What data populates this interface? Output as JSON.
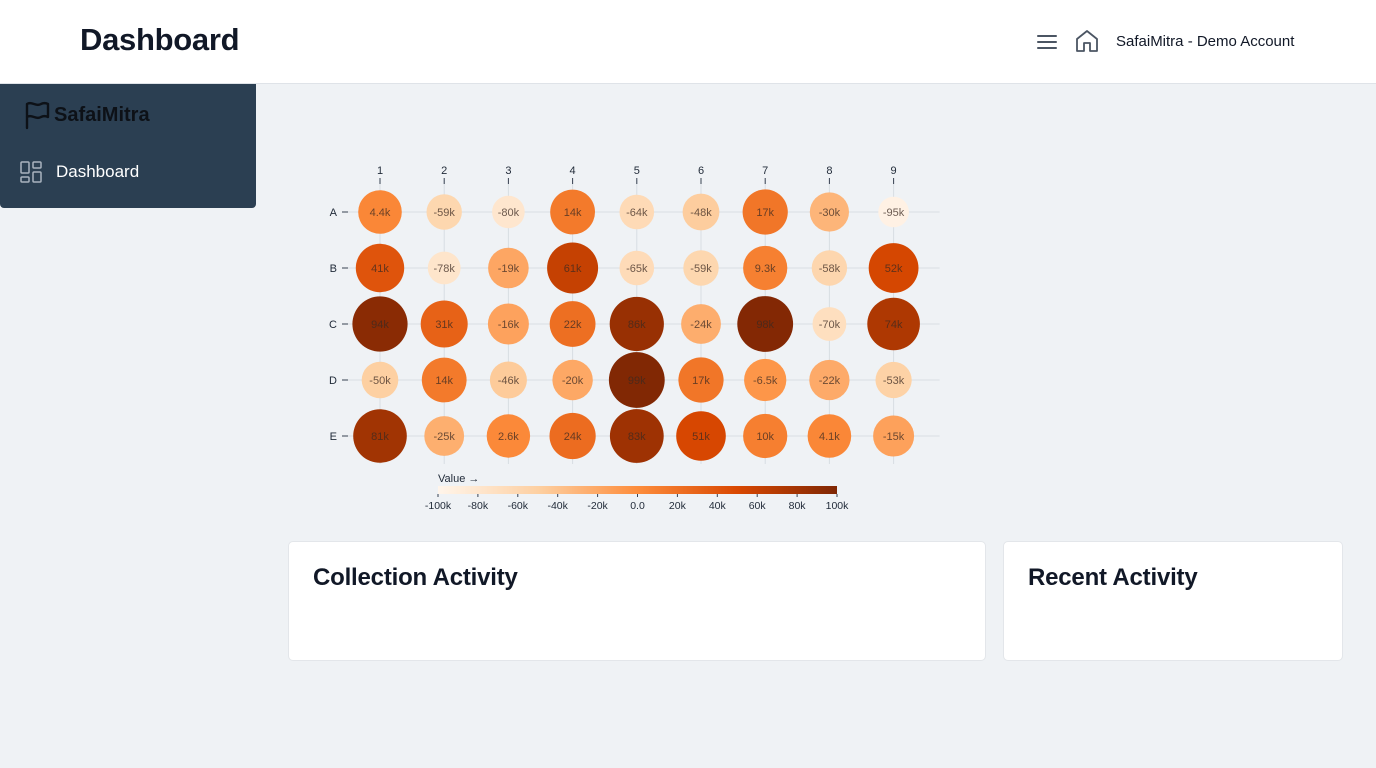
{
  "header": {
    "title": "Dashboard",
    "account": "SafaiMitra - Demo Account",
    "menu_icon": "hamburger-menu-icon",
    "home_icon": "home-icon"
  },
  "sidebar": {
    "brand": "SafaiMitra",
    "brand_icon": "flag-icon",
    "background": "#2b3f52",
    "items": [
      {
        "label": "Dashboard",
        "icon": "dashboard-grid-icon"
      }
    ]
  },
  "chart_data": {
    "type": "heatmap",
    "columns": [
      "1",
      "2",
      "3",
      "4",
      "5",
      "6",
      "7",
      "8",
      "9"
    ],
    "rows": [
      "A",
      "B",
      "C",
      "D",
      "E"
    ],
    "values": [
      [
        4400,
        -59000,
        -80000,
        14000,
        -64000,
        -48000,
        17000,
        -30000,
        -95000
      ],
      [
        41000,
        -78000,
        -19000,
        61000,
        -65000,
        -59000,
        9300,
        -58000,
        52000
      ],
      [
        94000,
        31000,
        -16000,
        22000,
        86000,
        -24000,
        98000,
        -70000,
        74000
      ],
      [
        -50000,
        14000,
        -46000,
        -20000,
        99000,
        17000,
        -6500,
        -22000,
        -53000
      ],
      [
        81000,
        -25000,
        2600,
        24000,
        83000,
        51000,
        10000,
        4100,
        -15000
      ]
    ],
    "labels": [
      [
        "4.4k",
        "-59k",
        "-80k",
        "14k",
        "-64k",
        "-48k",
        "17k",
        "-30k",
        "-95k"
      ],
      [
        "41k",
        "-78k",
        "-19k",
        "61k",
        "-65k",
        "-59k",
        "9.3k",
        "-58k",
        "52k"
      ],
      [
        "94k",
        "31k",
        "-16k",
        "22k",
        "86k",
        "-24k",
        "98k",
        "-70k",
        "74k"
      ],
      [
        "-50k",
        "14k",
        "-46k",
        "-20k",
        "99k",
        "17k",
        "-6.5k",
        "-22k",
        "-53k"
      ],
      [
        "81k",
        "-25k",
        "2.6k",
        "24k",
        "83k",
        "51k",
        "10k",
        "4.1k",
        "-15k"
      ]
    ],
    "legend": {
      "title": "Value →",
      "range": [
        -100000,
        100000
      ],
      "ticks": [
        "-100k",
        "-80k",
        "-60k",
        "-40k",
        "-20k",
        "0.0",
        "20k",
        "40k",
        "60k",
        "80k",
        "100k"
      ]
    },
    "color_scale": [
      "#fff5eb",
      "#fdd0a2",
      "#fd8d3c",
      "#d94801",
      "#7f2704"
    ],
    "grid": true
  },
  "cards": {
    "collection_title": "Collection Activity",
    "recent_title": "Recent Activity"
  }
}
